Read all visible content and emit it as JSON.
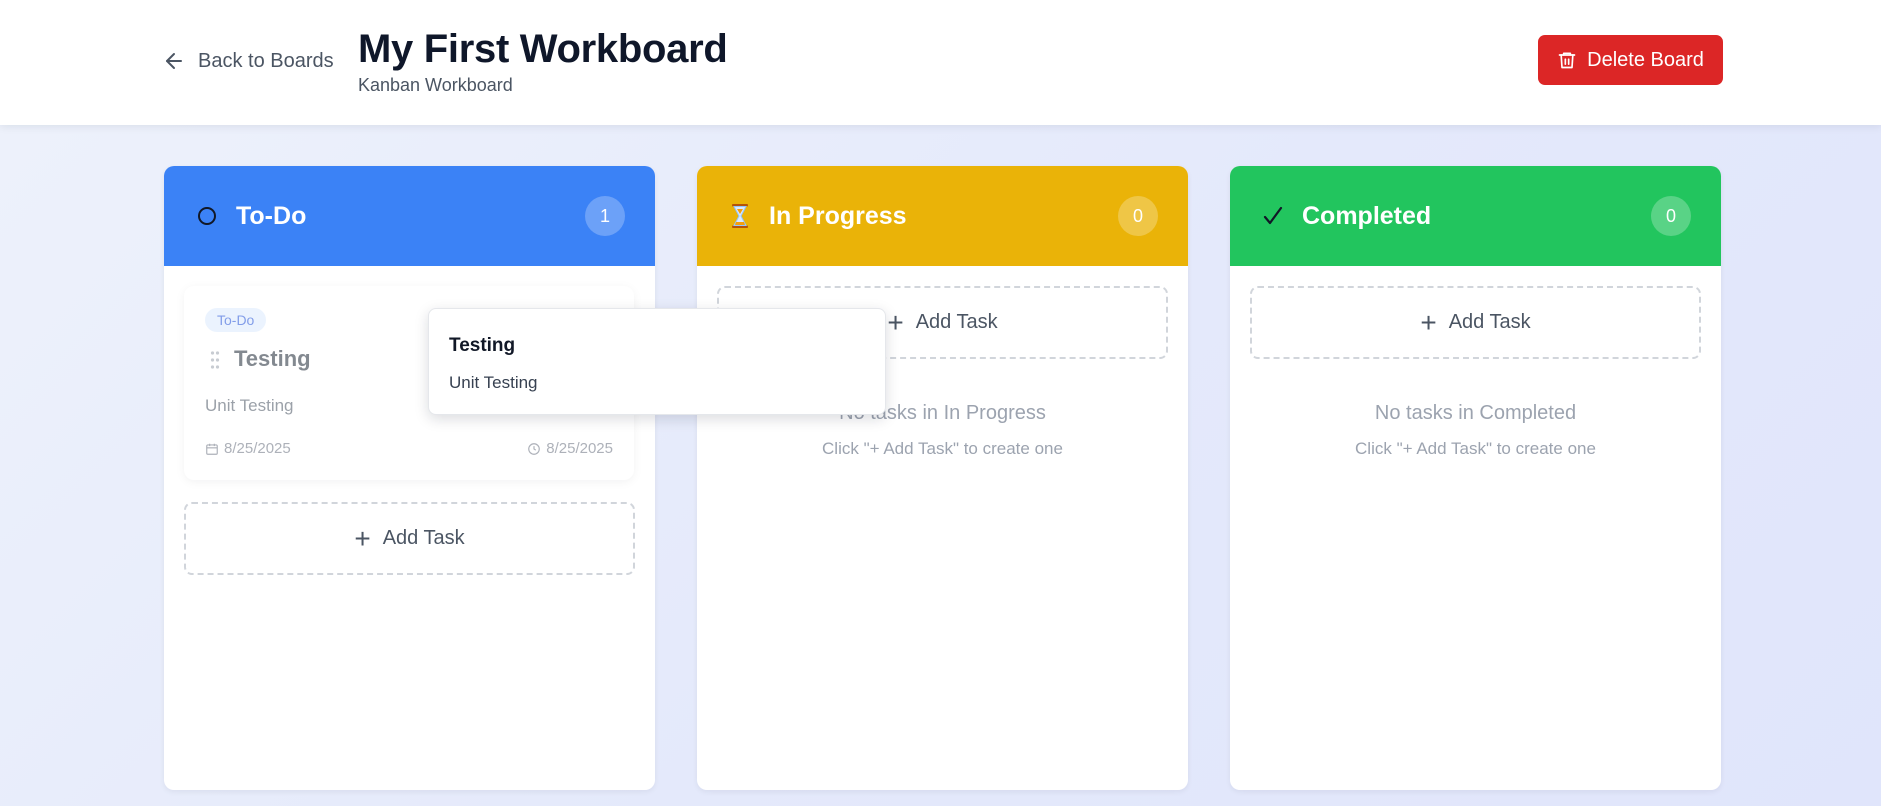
{
  "header": {
    "back_label": "Back to Boards",
    "title": "My First Workboard",
    "subtitle": "Kanban Workboard",
    "delete_label": "Delete Board"
  },
  "columns": [
    {
      "title": "To-Do",
      "icon": "circle-icon",
      "color": "#3b82f6",
      "count": "1",
      "add_label": "Add Task",
      "tasks": [
        {
          "status": "To-Do",
          "title": "Testing",
          "description": "Unit Testing",
          "created_date": "8/25/2025",
          "due_date": "8/25/2025"
        }
      ]
    },
    {
      "title": "In Progress",
      "icon": "hourglass-icon",
      "color": "#eab308",
      "count": "0",
      "add_label": "Add Task",
      "empty_title": "No tasks in In Progress",
      "empty_hint": "Click \"+ Add Task\" to create one"
    },
    {
      "title": "Completed",
      "icon": "checkmark-icon",
      "color": "#22c55e",
      "count": "0",
      "add_label": "Add Task",
      "empty_title": "No tasks in Completed",
      "empty_hint": "Click \"+ Add Task\" to create one"
    }
  ],
  "drag_preview": {
    "title": "Testing",
    "description": "Unit Testing"
  },
  "colors": {
    "delete": "#dc2626",
    "todo": "#3b82f6",
    "in_progress": "#eab308",
    "completed": "#22c55e"
  }
}
